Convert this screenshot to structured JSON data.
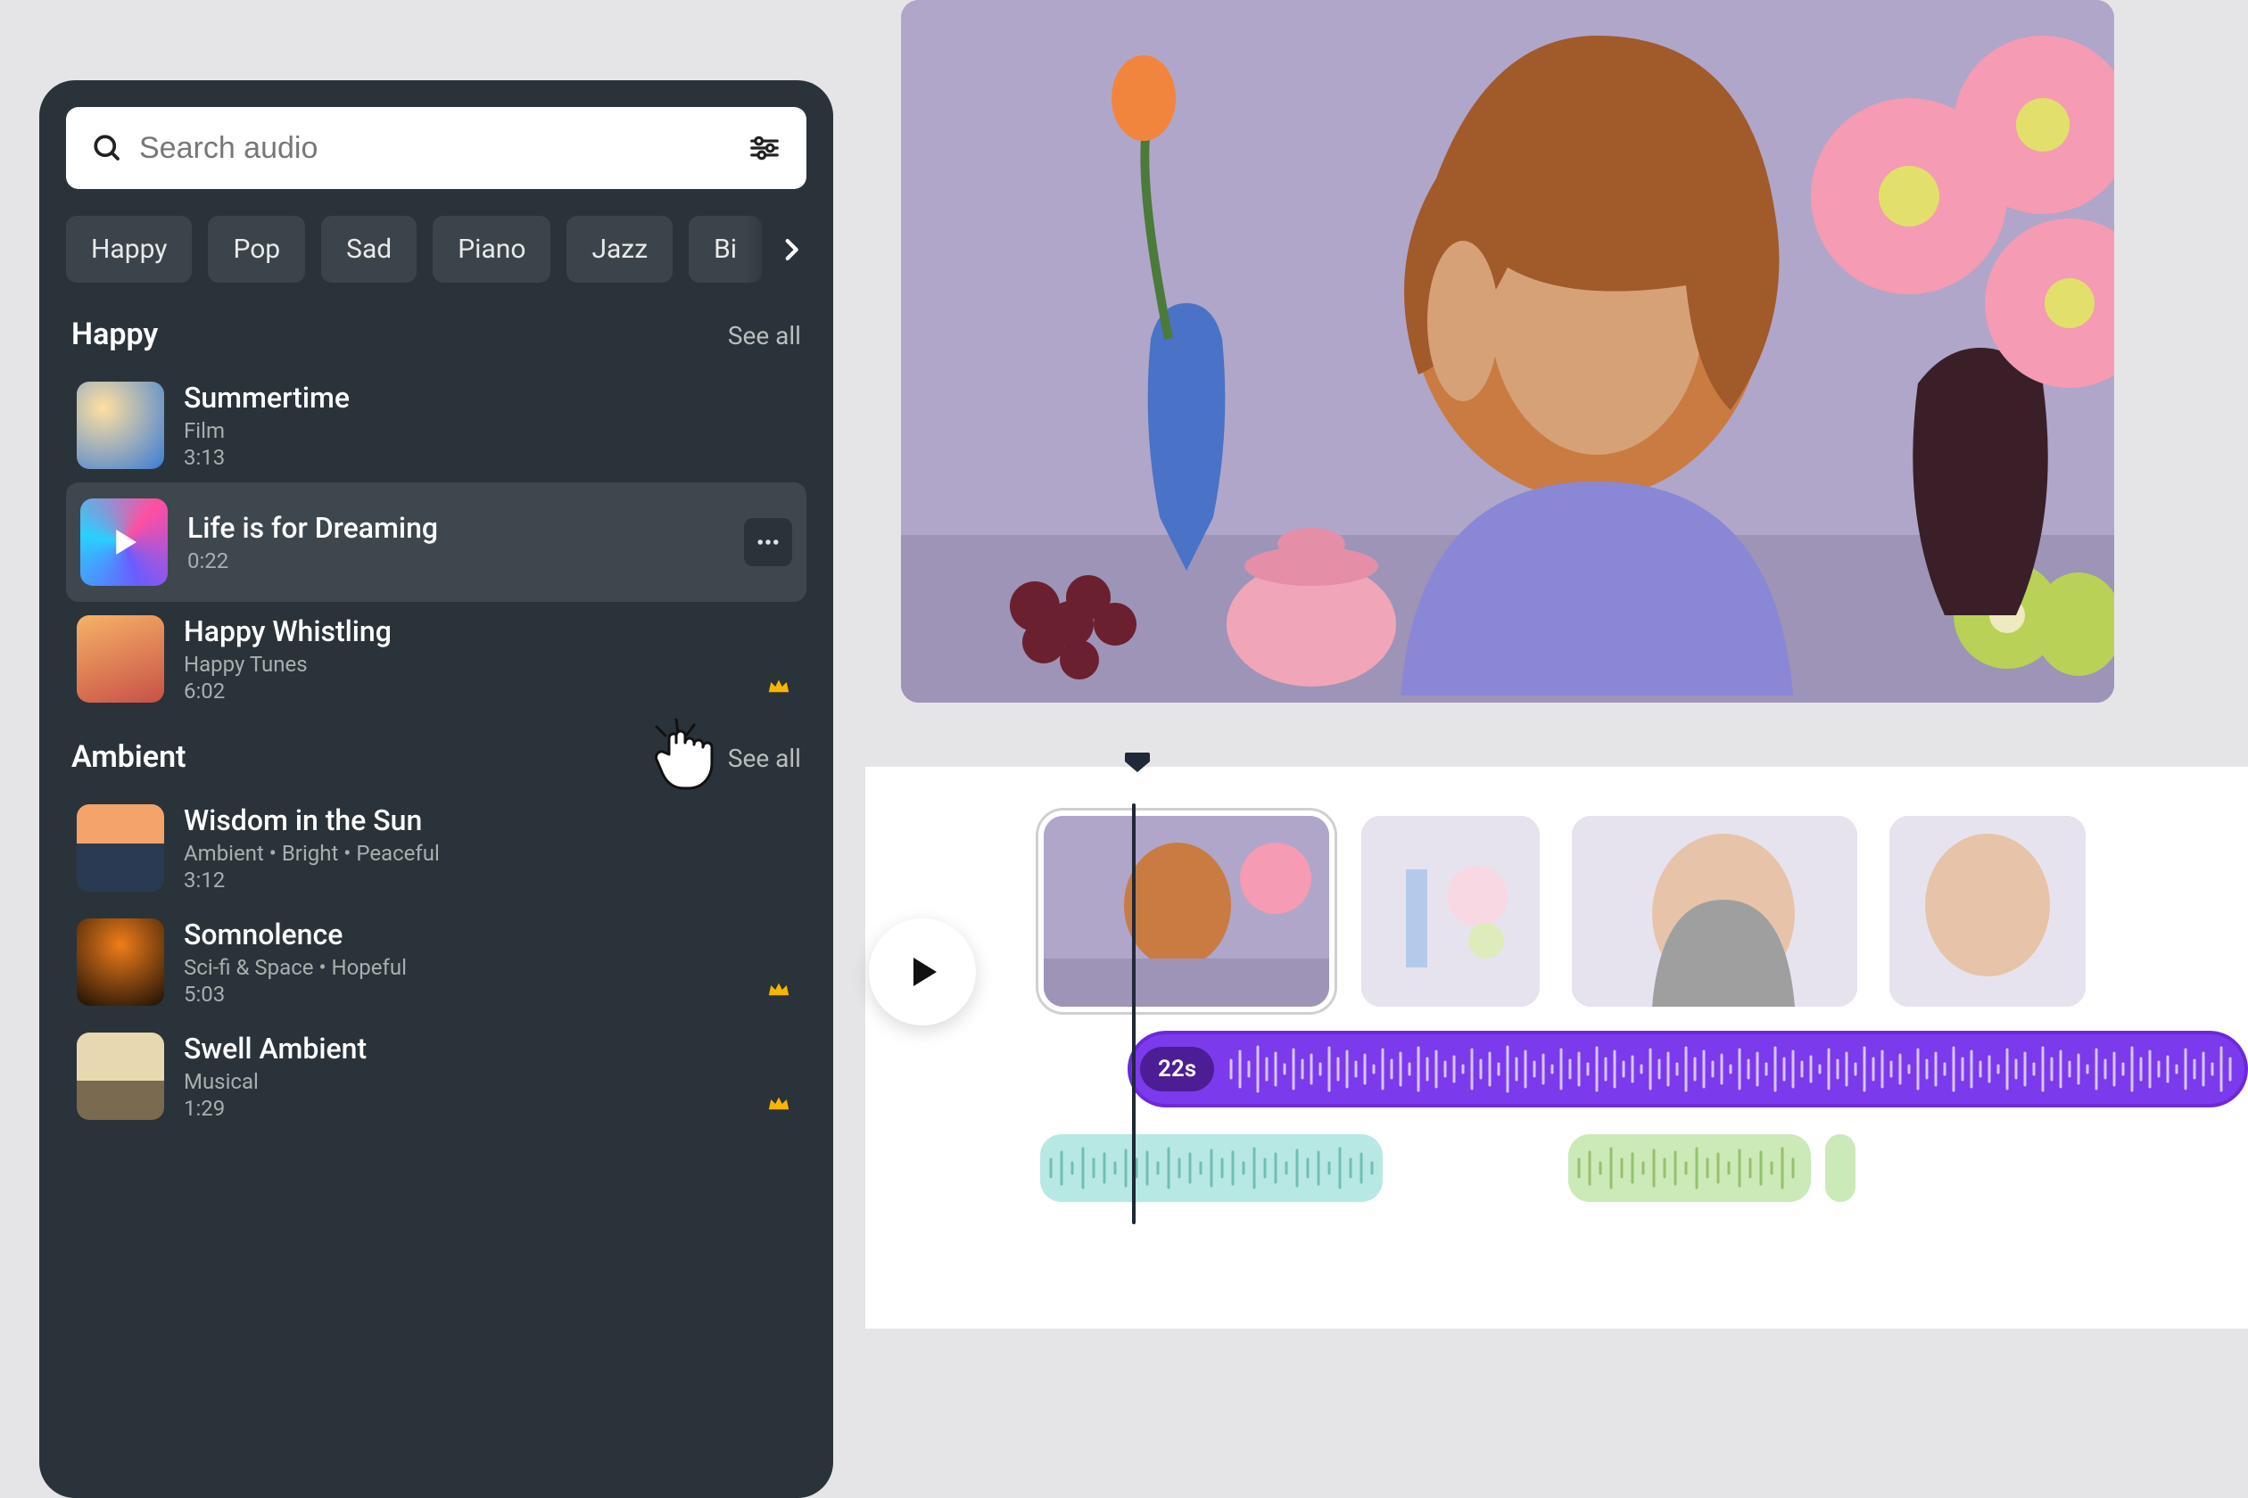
{
  "search": {
    "placeholder": "Search audio"
  },
  "chips": [
    "Happy",
    "Pop",
    "Sad",
    "Piano",
    "Jazz",
    "Bi"
  ],
  "sections": [
    {
      "title": "Happy",
      "see_all": "See all",
      "tracks": [
        {
          "title": "Summertime",
          "sub": "Film",
          "dur": "3:13",
          "thumb_a": "#3a7bd5",
          "thumb_b": "#f0c27b"
        },
        {
          "title": "Life is for Dreaming",
          "sub": "",
          "dur": "0:22",
          "selected": true,
          "thumb_a": "#c850c0",
          "thumb_b": "#4158d0"
        },
        {
          "title": "Happy Whistling",
          "sub": "Happy Tunes",
          "dur": "6:02",
          "crown": true,
          "thumb_a": "#f7b267",
          "thumb_b": "#c75146"
        }
      ]
    },
    {
      "title": "Ambient",
      "see_all": "See all",
      "tracks": [
        {
          "title": "Wisdom in the Sun",
          "sub": "Ambient • Bright • Peaceful",
          "dur": "3:12",
          "thumb_a": "#fdb99b",
          "thumb_b": "#2c3e50"
        },
        {
          "title": "Somnolence",
          "sub": "Sci-fi & Space • Hopeful",
          "dur": "5:03",
          "crown": true,
          "thumb_a": "#e65c00",
          "thumb_b": "#1a1005"
        },
        {
          "title": "Swell Ambient",
          "sub": "Musical",
          "dur": "1:29",
          "crown": true,
          "thumb_a": "#e8d8b0",
          "thumb_b": "#7a6a4f"
        }
      ]
    }
  ],
  "timeline": {
    "audio_badge": "22s"
  }
}
